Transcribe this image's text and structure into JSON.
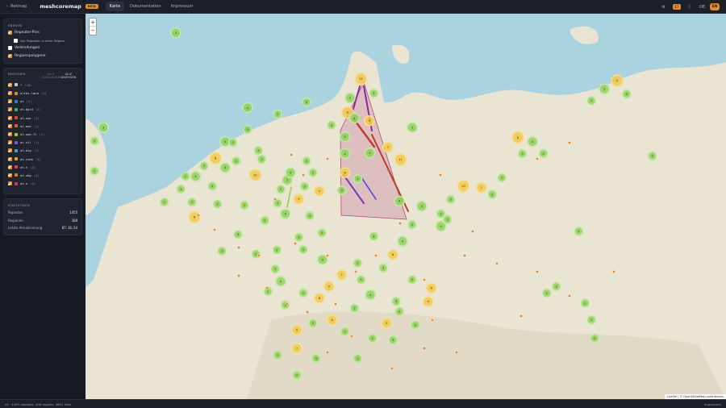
{
  "topbar": {
    "back_label": "Rekmap",
    "brand": "meshcoremap",
    "beta": "BETA",
    "tabs": [
      {
        "label": "Karte",
        "active": true
      },
      {
        "label": "Dokumentation",
        "active": false
      },
      {
        "label": "Impressum",
        "active": false
      }
    ],
    "badge_count": "17",
    "lang": "DE",
    "avatar": "EN"
  },
  "sidebar": {
    "layers": {
      "title": "EBENEN",
      "items": [
        {
          "label": "Repeater-Pins",
          "checked": true,
          "sub": false
        },
        {
          "label": "Nur Repeater in einer Region",
          "checked": false,
          "sub": true
        },
        {
          "label": "Verbindungen",
          "checked": false,
          "sub": false
        },
        {
          "label": "Regionspolygone",
          "checked": true,
          "sub": false
        }
      ]
    },
    "regions": {
      "title": "REGIONEN",
      "hide_all": "ALLE AUSBLENDEN",
      "show_all": "ALLE ANZEIGEN",
      "items": [
        {
          "name": "*",
          "count": "(28)",
          "color": "#c8c8c8"
        },
        {
          "name": "altes-land",
          "count": "(4)",
          "color": "#e8892b"
        },
        {
          "name": "at",
          "count": "(4)",
          "color": "#3a7bd5"
        },
        {
          "name": "at-bgld",
          "count": "(2)",
          "color": "#2bb673"
        },
        {
          "name": "at-noe",
          "count": "(4)",
          "color": "#d94b3a"
        },
        {
          "name": "at-ooe",
          "count": "(2)",
          "color": "#e05a3a"
        },
        {
          "name": "at-ooe-fl",
          "count": "(1)",
          "color": "#9bd33c"
        },
        {
          "name": "at-stl",
          "count": "(1)",
          "color": "#7f55d9"
        },
        {
          "name": "at-dig",
          "count": "(2)",
          "color": "#3aa7d9"
        },
        {
          "name": "at-stmk",
          "count": "(3)",
          "color": "#d9a03a"
        },
        {
          "name": "at-t",
          "count": "(3)",
          "color": "#d93a7a"
        },
        {
          "name": "at-vbg",
          "count": "(3)",
          "color": "#e07a30"
        },
        {
          "name": "at-w",
          "count": "(3)",
          "color": "#c73a6a"
        }
      ]
    },
    "stats": {
      "title": "STATISTIKEN",
      "rows": [
        {
          "label": "Repeater",
          "value": "1455"
        },
        {
          "label": "Regionen",
          "value": "108"
        },
        {
          "label": "Letzte Aktualisierung",
          "value": "07:16:34"
        }
      ]
    }
  },
  "map": {
    "zoom_in": "+",
    "zoom_out": "−",
    "attribution": "Leaflet | © OpenStreetMap contributors",
    "clusters": [
      {
        "cx": 14.1,
        "cy": 5.7,
        "r": 6,
        "color": "green",
        "label": "3"
      },
      {
        "cx": 43.0,
        "cy": 19.5,
        "r": 7,
        "color": "yellow",
        "label": "12"
      },
      {
        "cx": 41.3,
        "cy": 25.2,
        "r": 6,
        "color": "green",
        "label": "5"
      },
      {
        "cx": 45.0,
        "cy": 23.8,
        "r": 5,
        "color": "green",
        "label": "2"
      },
      {
        "cx": 40.9,
        "cy": 29.5,
        "r": 7,
        "color": "yellow",
        "label": "8"
      },
      {
        "cx": 42.0,
        "cy": 31.2,
        "r": 6,
        "color": "green",
        "label": "4"
      },
      {
        "cx": 44.3,
        "cy": 32.0,
        "r": 6,
        "color": "yellow",
        "label": "9"
      },
      {
        "cx": 38.4,
        "cy": 33.3,
        "r": 5,
        "color": "green",
        "label": "3"
      },
      {
        "cx": 47.2,
        "cy": 39.9,
        "r": 6,
        "color": "yellow",
        "label": "7"
      },
      {
        "cx": 44.4,
        "cy": 41.6,
        "r": 6,
        "color": "green",
        "label": "5"
      },
      {
        "cx": 40.5,
        "cy": 41.8,
        "r": 6,
        "color": "green",
        "label": "4"
      },
      {
        "cx": 49.2,
        "cy": 43.6,
        "r": 7,
        "color": "yellow",
        "label": "11"
      },
      {
        "cx": 40.5,
        "cy": 47.5,
        "r": 6,
        "color": "yellow",
        "label": "6"
      },
      {
        "cx": 42.5,
        "cy": 49.3,
        "r": 5,
        "color": "green",
        "label": "2"
      },
      {
        "cx": 40.0,
        "cy": 52.8,
        "r": 5,
        "color": "green",
        "label": "3"
      },
      {
        "cx": 25.3,
        "cy": 28.1,
        "r": 6,
        "color": "green",
        "label": "4"
      },
      {
        "cx": 34.5,
        "cy": 26.4,
        "r": 5,
        "color": "green",
        "label": "2"
      },
      {
        "cx": 25.3,
        "cy": 34.6,
        "r": 5,
        "color": "green",
        "label": "3"
      },
      {
        "cx": 30.0,
        "cy": 30.0,
        "r": 5,
        "color": "green",
        "label": "2"
      },
      {
        "cx": 40.5,
        "cy": 36.8,
        "r": 6,
        "color": "green",
        "label": "5"
      },
      {
        "cx": 2.8,
        "cy": 34.0,
        "r": 6,
        "color": "green",
        "label": "3"
      },
      {
        "cx": 1.4,
        "cy": 38.0,
        "r": 5,
        "color": "green",
        "label": "2"
      },
      {
        "cx": 1.4,
        "cy": 47.0,
        "r": 5,
        "color": "green",
        "label": "2"
      },
      {
        "cx": 21.8,
        "cy": 38.2,
        "r": 6,
        "color": "green",
        "label": "4"
      },
      {
        "cx": 27.0,
        "cy": 40.9,
        "r": 5,
        "color": "green",
        "label": "3"
      },
      {
        "cx": 23.5,
        "cy": 44.0,
        "r": 5,
        "color": "green",
        "label": "2"
      },
      {
        "cx": 20.3,
        "cy": 43.2,
        "r": 7,
        "color": "yellow",
        "label": "8"
      },
      {
        "cx": 18.5,
        "cy": 45.5,
        "r": 5,
        "color": "green",
        "label": "3"
      },
      {
        "cx": 21.8,
        "cy": 46.0,
        "r": 6,
        "color": "green",
        "label": "4"
      },
      {
        "cx": 26.5,
        "cy": 48.2,
        "r": 7,
        "color": "yellow",
        "label": "10"
      },
      {
        "cx": 15.6,
        "cy": 48.6,
        "r": 5,
        "color": "green",
        "label": "2"
      },
      {
        "cx": 17.2,
        "cy": 48.6,
        "r": 6,
        "color": "green",
        "label": "4"
      },
      {
        "cx": 14.9,
        "cy": 52.4,
        "r": 5,
        "color": "green",
        "label": "3"
      },
      {
        "cx": 19.8,
        "cy": 51.5,
        "r": 5,
        "color": "green",
        "label": "2"
      },
      {
        "cx": 16.6,
        "cy": 56.3,
        "r": 5,
        "color": "green",
        "label": "3"
      },
      {
        "cx": 12.3,
        "cy": 56.3,
        "r": 5,
        "color": "green",
        "label": "2"
      },
      {
        "cx": 31.5,
        "cy": 49.7,
        "r": 6,
        "color": "green",
        "label": "5"
      },
      {
        "cx": 34.2,
        "cy": 51.6,
        "r": 5,
        "color": "green",
        "label": "3"
      },
      {
        "cx": 36.5,
        "cy": 53.0,
        "r": 6,
        "color": "yellow",
        "label": "7"
      },
      {
        "cx": 33.3,
        "cy": 55.4,
        "r": 6,
        "color": "yellow",
        "label": "9"
      },
      {
        "cx": 30.0,
        "cy": 56.6,
        "r": 5,
        "color": "green",
        "label": "3"
      },
      {
        "cx": 31.2,
        "cy": 59.8,
        "r": 6,
        "color": "green",
        "label": "4"
      },
      {
        "cx": 24.8,
        "cy": 57.2,
        "r": 5,
        "color": "green",
        "label": "2"
      },
      {
        "cx": 20.6,
        "cy": 56.9,
        "r": 5,
        "color": "green",
        "label": "2"
      },
      {
        "cx": 17.0,
        "cy": 60.8,
        "r": 7,
        "color": "yellow",
        "label": "6"
      },
      {
        "cx": 28.0,
        "cy": 61.8,
        "r": 5,
        "color": "green",
        "label": "2"
      },
      {
        "cx": 35.0,
        "cy": 60.4,
        "r": 5,
        "color": "green",
        "label": "3"
      },
      {
        "cx": 36.9,
        "cy": 65.5,
        "r": 5,
        "color": "green",
        "label": "2"
      },
      {
        "cx": 33.3,
        "cy": 66.8,
        "r": 5,
        "color": "green",
        "label": "3"
      },
      {
        "cx": 29.9,
        "cy": 70.6,
        "r": 5,
        "color": "green",
        "label": "2"
      },
      {
        "cx": 23.8,
        "cy": 66.0,
        "r": 5,
        "color": "green",
        "label": "3"
      },
      {
        "cx": 21.3,
        "cy": 70.9,
        "r": 5,
        "color": "green",
        "label": "2"
      },
      {
        "cx": 26.6,
        "cy": 71.8,
        "r": 5,
        "color": "green",
        "label": "2"
      },
      {
        "cx": 37.0,
        "cy": 73.5,
        "r": 6,
        "color": "green",
        "label": "4"
      },
      {
        "cx": 29.6,
        "cy": 76.3,
        "r": 5,
        "color": "green",
        "label": "3"
      },
      {
        "cx": 30.5,
        "cy": 80.0,
        "r": 6,
        "color": "green",
        "label": "4"
      },
      {
        "cx": 28.5,
        "cy": 83.0,
        "r": 5,
        "color": "green",
        "label": "2"
      },
      {
        "cx": 31.2,
        "cy": 87.0,
        "r": 5,
        "color": "green",
        "label": "3"
      },
      {
        "cx": 34.0,
        "cy": 83.5,
        "r": 5,
        "color": "green",
        "label": "2"
      },
      {
        "cx": 36.5,
        "cy": 85.0,
        "r": 6,
        "color": "yellow",
        "label": "8"
      },
      {
        "cx": 38.0,
        "cy": 81.5,
        "r": 6,
        "color": "yellow",
        "label": "9"
      },
      {
        "cx": 40.0,
        "cy": 78.0,
        "r": 6,
        "color": "yellow",
        "label": "7"
      },
      {
        "cx": 43.0,
        "cy": 79.5,
        "r": 5,
        "color": "green",
        "label": "3"
      },
      {
        "cx": 44.5,
        "cy": 84.0,
        "r": 6,
        "color": "green",
        "label": "4"
      },
      {
        "cx": 42.0,
        "cy": 88.0,
        "r": 5,
        "color": "green",
        "label": "2"
      },
      {
        "cx": 38.5,
        "cy": 91.5,
        "r": 6,
        "color": "yellow",
        "label": "6"
      },
      {
        "cx": 35.5,
        "cy": 92.5,
        "r": 5,
        "color": "green",
        "label": "3"
      },
      {
        "cx": 33.0,
        "cy": 94.5,
        "r": 6,
        "color": "yellow",
        "label": "5"
      },
      {
        "cx": 40.5,
        "cy": 95.0,
        "r": 5,
        "color": "green",
        "label": "2"
      },
      {
        "cx": 33.0,
        "cy": 100.0,
        "r": 6,
        "color": "yellow",
        "label": "7"
      },
      {
        "cx": 36.0,
        "cy": 103.0,
        "r": 5,
        "color": "green",
        "label": "3"
      },
      {
        "cx": 30.0,
        "cy": 102.0,
        "r": 5,
        "color": "green",
        "label": "2"
      },
      {
        "cx": 33.0,
        "cy": 108.0,
        "r": 5,
        "color": "green",
        "label": "2"
      },
      {
        "cx": 45.0,
        "cy": 66.5,
        "r": 5,
        "color": "green",
        "label": "3"
      },
      {
        "cx": 49.5,
        "cy": 68.0,
        "r": 6,
        "color": "green",
        "label": "4"
      },
      {
        "cx": 48.0,
        "cy": 72.0,
        "r": 6,
        "color": "yellow",
        "label": "8"
      },
      {
        "cx": 46.5,
        "cy": 76.0,
        "r": 5,
        "color": "green",
        "label": "3"
      },
      {
        "cx": 51.0,
        "cy": 79.5,
        "r": 5,
        "color": "green",
        "label": "2"
      },
      {
        "cx": 54.0,
        "cy": 82.0,
        "r": 6,
        "color": "yellow",
        "label": "6"
      },
      {
        "cx": 48.5,
        "cy": 86.0,
        "r": 5,
        "color": "green",
        "label": "3"
      },
      {
        "cx": 53.5,
        "cy": 86.0,
        "r": 6,
        "color": "yellow",
        "label": "9"
      },
      {
        "cx": 49.0,
        "cy": 89.0,
        "r": 5,
        "color": "green",
        "label": "2"
      },
      {
        "cx": 47.0,
        "cy": 92.5,
        "r": 6,
        "color": "yellow",
        "label": "5"
      },
      {
        "cx": 51.5,
        "cy": 93.0,
        "r": 5,
        "color": "green",
        "label": "2"
      },
      {
        "cx": 48.0,
        "cy": 97.5,
        "r": 5,
        "color": "green",
        "label": "3"
      },
      {
        "cx": 44.8,
        "cy": 97.0,
        "r": 5,
        "color": "green",
        "label": "2"
      },
      {
        "cx": 42.5,
        "cy": 103.0,
        "r": 5,
        "color": "green",
        "label": "2"
      },
      {
        "cx": 57.0,
        "cy": 55.5,
        "r": 5,
        "color": "green",
        "label": "3"
      },
      {
        "cx": 52.5,
        "cy": 57.5,
        "r": 6,
        "color": "green",
        "label": "4"
      },
      {
        "cx": 55.5,
        "cy": 59.8,
        "r": 5,
        "color": "green",
        "label": "2"
      },
      {
        "cx": 59.0,
        "cy": 51.5,
        "r": 7,
        "color": "yellow",
        "label": "10"
      },
      {
        "cx": 56.5,
        "cy": 61.5,
        "r": 5,
        "color": "green",
        "label": "3"
      },
      {
        "cx": 51.0,
        "cy": 63.0,
        "r": 5,
        "color": "green",
        "label": "2"
      },
      {
        "cx": 55.5,
        "cy": 63.5,
        "r": 6,
        "color": "green",
        "label": "4"
      },
      {
        "cx": 63.5,
        "cy": 54.0,
        "r": 5,
        "color": "green",
        "label": "2"
      },
      {
        "cx": 69.8,
        "cy": 38.2,
        "r": 6,
        "color": "green",
        "label": "4"
      },
      {
        "cx": 67.5,
        "cy": 37.0,
        "r": 7,
        "color": "yellow",
        "label": "8"
      },
      {
        "cx": 68.2,
        "cy": 41.8,
        "r": 5,
        "color": "green",
        "label": "3"
      },
      {
        "cx": 71.5,
        "cy": 41.8,
        "r": 5,
        "color": "green",
        "label": "2"
      },
      {
        "cx": 61.8,
        "cy": 52.0,
        "r": 6,
        "color": "yellow",
        "label": "7"
      },
      {
        "cx": 65.0,
        "cy": 49.0,
        "r": 5,
        "color": "green",
        "label": "2"
      },
      {
        "cx": 49.0,
        "cy": 56.0,
        "r": 6,
        "color": "green",
        "label": "4"
      },
      {
        "cx": 81.0,
        "cy": 22.5,
        "r": 6,
        "color": "green",
        "label": "3"
      },
      {
        "cx": 83.0,
        "cy": 20.0,
        "r": 7,
        "color": "yellow",
        "label": "9"
      },
      {
        "cx": 84.5,
        "cy": 24.0,
        "r": 5,
        "color": "green",
        "label": "2"
      },
      {
        "cx": 79.0,
        "cy": 26.0,
        "r": 5,
        "color": "green",
        "label": "2"
      },
      {
        "cx": 88.5,
        "cy": 42.5,
        "r": 5,
        "color": "green",
        "label": "3"
      },
      {
        "cx": 77.0,
        "cy": 65.0,
        "r": 5,
        "color": "green",
        "label": "2"
      },
      {
        "cx": 73.5,
        "cy": 81.5,
        "r": 5,
        "color": "green",
        "label": "3"
      },
      {
        "cx": 72.0,
        "cy": 83.5,
        "r": 5,
        "color": "green",
        "label": "2"
      },
      {
        "cx": 78.0,
        "cy": 86.5,
        "r": 5,
        "color": "green",
        "label": "2"
      },
      {
        "cx": 79.0,
        "cy": 91.5,
        "r": 5,
        "color": "green",
        "label": "2"
      },
      {
        "cx": 79.5,
        "cy": 97.0,
        "r": 5,
        "color": "green",
        "label": "3"
      },
      {
        "cx": 23.0,
        "cy": 38.5,
        "r": 5,
        "color": "green",
        "label": "2"
      },
      {
        "cx": 27.5,
        "cy": 43.5,
        "r": 5,
        "color": "green",
        "label": "3"
      },
      {
        "cx": 34.5,
        "cy": 44.0,
        "r": 5,
        "color": "green",
        "label": "3"
      },
      {
        "cx": 35.5,
        "cy": 47.5,
        "r": 5,
        "color": "green",
        "label": "2"
      },
      {
        "cx": 32.0,
        "cy": 47.5,
        "r": 6,
        "color": "green",
        "label": "4"
      },
      {
        "cx": 30.5,
        "cy": 52.5,
        "r": 5,
        "color": "green",
        "label": "2"
      },
      {
        "cx": 51.0,
        "cy": 34.0,
        "r": 6,
        "color": "green",
        "label": "5"
      },
      {
        "cx": 34.0,
        "cy": 70.5,
        "r": 5,
        "color": "green",
        "label": "3"
      },
      {
        "cx": 42.5,
        "cy": 74.5,
        "r": 5,
        "color": "green",
        "label": "2"
      }
    ]
  },
  "footer": {
    "left": "v4 · 1455 repeater, 108 regions, 3851 links",
    "right": "Impressum"
  }
}
